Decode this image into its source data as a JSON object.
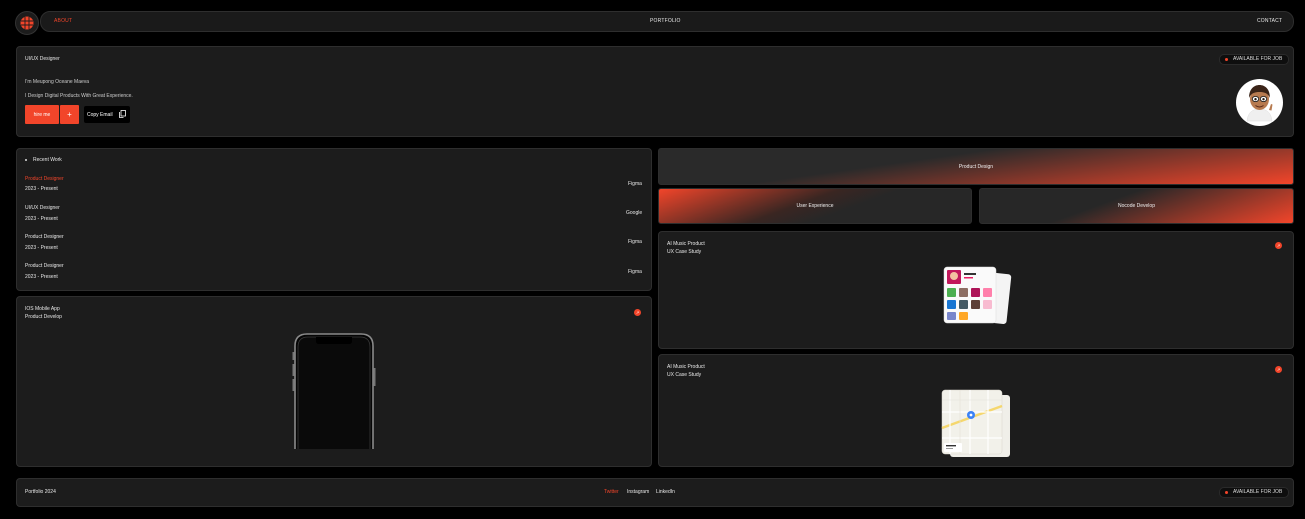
{
  "nav": {
    "about": "ABOUT",
    "portfolio": "PORTFOLIO",
    "contact": "CONTACT"
  },
  "hero": {
    "role": "UI/UX Designer",
    "badge": "AVAILABLE FOR JOB",
    "name_line": "I'm Meupong Oceane Maeva",
    "tagline": "I Design Digital Products With Great Experience.",
    "hire_label": "hire me",
    "plus_label": "+",
    "copy_label": "Copy Email"
  },
  "work": {
    "heading": "Recent Work",
    "items": [
      {
        "role": "Product Designer",
        "date": "2023 - Present",
        "tool": "Figma"
      },
      {
        "role": "UI/UX Designer",
        "date": "2023 - Present",
        "tool": "Google"
      },
      {
        "role": "Product Designer",
        "date": "2023 - Present",
        "tool": "Figma"
      },
      {
        "role": "Product Designer",
        "date": "2023 - Present",
        "tool": "Figma"
      }
    ]
  },
  "ios": {
    "title": "IOS Mobile App",
    "subtitle": "Product Develop"
  },
  "skills": {
    "product_design": "Product Design",
    "user_experience": "User Experience",
    "nocode": "Nocode Develop"
  },
  "cases": [
    {
      "title": "AI Music Product",
      "subtitle": "UX Case Study"
    },
    {
      "title": "AI Music Product",
      "subtitle": "UX Case Study"
    }
  ],
  "footer": {
    "copyright": "Portfolio 2024",
    "twitter": "Twitter",
    "instagram": "Instagram",
    "linkedin": "LinkedIn",
    "badge": "AVAILABLE FOR JOB"
  },
  "colors": {
    "accent": "#f2452a",
    "card": "#1c1c1c",
    "background": "#000000"
  }
}
